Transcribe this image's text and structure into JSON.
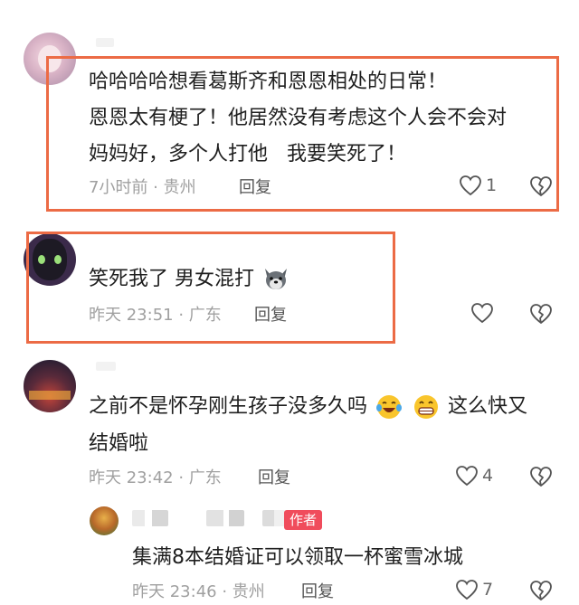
{
  "comments": [
    {
      "text_lines": [
        "哈哈哈哈想看葛斯齐和恩恩相处的日常！",
        "恩恩太有梗了！他居然没有考虑这个人会不会对",
        "妈妈好，多个人打他   我要笑死了！"
      ],
      "time_location": "7小时前 · 贵州",
      "reply_label": "回复",
      "like_count": "1"
    },
    {
      "text": "笑死我了 男女混打",
      "emoji_icon": "wolf-face-icon",
      "time_location": "昨天 23:51 · 广东",
      "reply_label": "回复",
      "like_count": ""
    },
    {
      "text_line1": "之前不是怀孕刚生孩子没多久吗",
      "text_line1_suffix": "这么快又",
      "text_line2": "结婚啦",
      "emoji_icons": [
        "laughing-tears-icon",
        "grin-icon"
      ],
      "time_location": "昨天 23:42 · 广东",
      "reply_label": "回复",
      "like_count": "4",
      "reply": {
        "author_tag": "作者",
        "text": "集满8本结婚证可以领取一杯蜜雪冰城",
        "time_location": "昨天 23:46 · 贵州",
        "reply_label": "回复",
        "like_count": "7"
      }
    }
  ],
  "colors": {
    "highlight": "#ec6b45",
    "author_tag": "#f04c5c",
    "meta_text": "#a0a0a0"
  }
}
